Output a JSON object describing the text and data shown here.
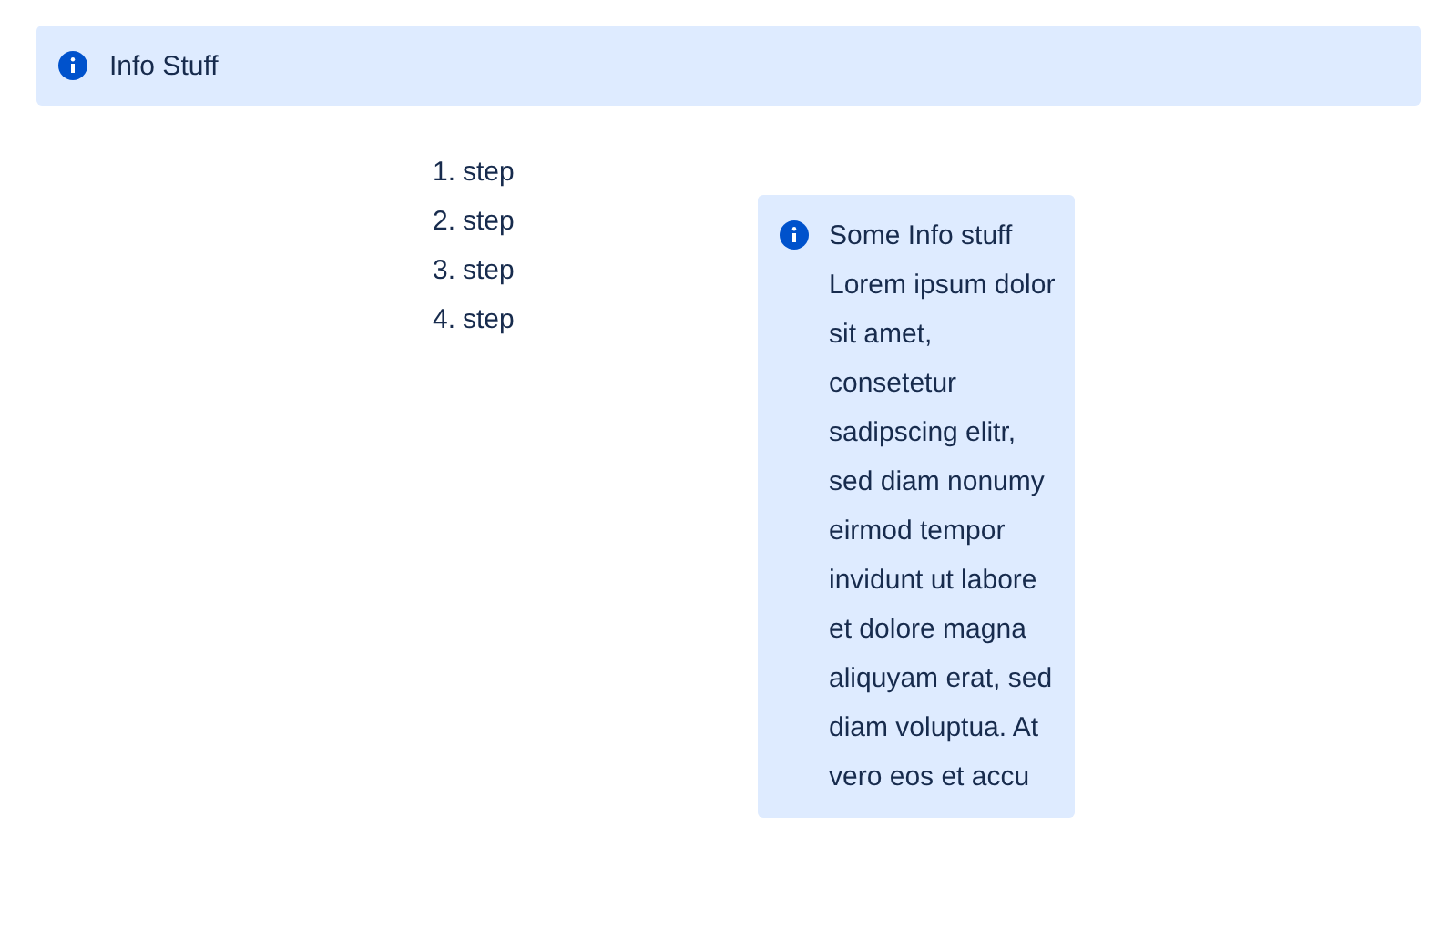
{
  "banner": {
    "title": "Info Stuff"
  },
  "steps": [
    {
      "number": "1.",
      "text": "step"
    },
    {
      "number": "2.",
      "text": "step"
    },
    {
      "number": "3.",
      "text": "step"
    },
    {
      "number": "4.",
      "text": "step"
    }
  ],
  "info_panel": {
    "text": "Some Info stuff Lorem ipsum dolor sit amet, consetetur sadipscing elitr, sed diam nonumy eirmod tempor invidunt ut labore et dolore magna aliquyam erat, sed diam voluptua. At vero eos et accu"
  }
}
